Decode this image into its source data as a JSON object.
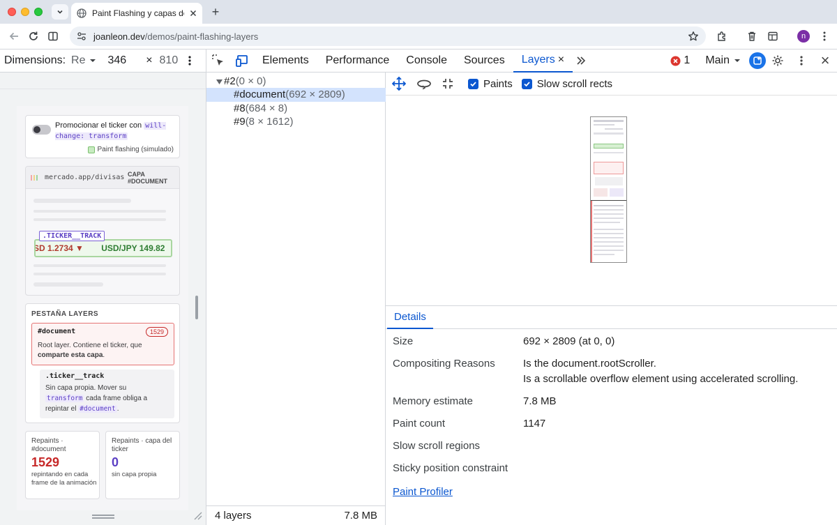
{
  "browser": {
    "tab_title": "Paint Flashing y capas de con",
    "new_tab_glyph": "+",
    "url_host": "joanleon.dev",
    "url_path": "/demos/paint-flashing-layers",
    "profile_initial": "n"
  },
  "device_toolbar": {
    "label": "Dimensions:",
    "preset": "Re",
    "width": "346",
    "times": "×",
    "height": "810"
  },
  "page": {
    "toggle_text": "Promocionar el ticker con",
    "toggle_code": "will-change: transform",
    "paint_flashing_label": "Paint flashing (simulado)",
    "browser_url": "mercado.app/divisas",
    "layer_tag_line1": "CAPA",
    "layer_tag_line2": "#DOCUMENT",
    "ticker_label": ".TICKER__TRACK",
    "ticker_item1": "SD 1.2734 ▼",
    "ticker_item2": "USD/JPY 149.82",
    "layers_heading": "PESTAÑA LAYERS",
    "doc_layer_name": "#document",
    "doc_layer_count": "1529",
    "doc_layer_desc_1": "Root layer. Contiene el ticker, que",
    "doc_layer_desc_bold": "comparte esta capa",
    "doc_layer_desc_2": ".",
    "track_name": ".ticker__track",
    "track_desc_1": "Sin capa propia. Mover su",
    "track_code_1": "transform",
    "track_desc_2": "cada frame obliga a",
    "track_desc_3": "repintar el",
    "track_code_2": "#document",
    "track_desc_4": ".",
    "stat1_label": "Repaints · #document",
    "stat1_value": "1529",
    "stat1_desc": "repintando en cada frame de la animación",
    "stat2_label": "Repaints · capa del ticker",
    "stat2_value": "0",
    "stat2_desc": "sin capa propia"
  },
  "devtools": {
    "tabs": [
      "Elements",
      "Performance",
      "Console",
      "Sources",
      "Layers"
    ],
    "active_tab": "Layers",
    "tab_close": "×",
    "more_tabs": "»",
    "error_count": "1",
    "context": "Main",
    "close": "×"
  },
  "layer_tree": {
    "rows": [
      {
        "name": "#2",
        "dims": "(0 × 0)"
      },
      {
        "name": "#document",
        "dims": "(692 × 2809)"
      },
      {
        "name": "#8",
        "dims": "(684 × 8)"
      },
      {
        "name": "#9",
        "dims": "(8 × 1612)"
      }
    ],
    "footer_count": "4 layers",
    "footer_memory": "7.8 MB"
  },
  "layers_toolbar": {
    "paints_label": "Paints",
    "slow_scroll_label": "Slow scroll rects"
  },
  "details": {
    "tab": "Details",
    "size_key": "Size",
    "size_val": "692 × 2809 (at 0, 0)",
    "reasons_key": "Compositing Reasons",
    "reasons_val_1": "Is the document.rootScroller.",
    "reasons_val_2": "Is a scrollable overflow element using accelerated scrolling.",
    "memory_key": "Memory estimate",
    "memory_val": "7.8 MB",
    "paint_count_key": "Paint count",
    "paint_count_val": "1147",
    "slow_scroll_key": "Slow scroll regions",
    "sticky_key": "Sticky position constraint",
    "profiler_link": "Paint Profiler"
  },
  "colors": {
    "accent": "#0b57d0",
    "danger": "#c62828",
    "code": "#5b3fc4"
  }
}
